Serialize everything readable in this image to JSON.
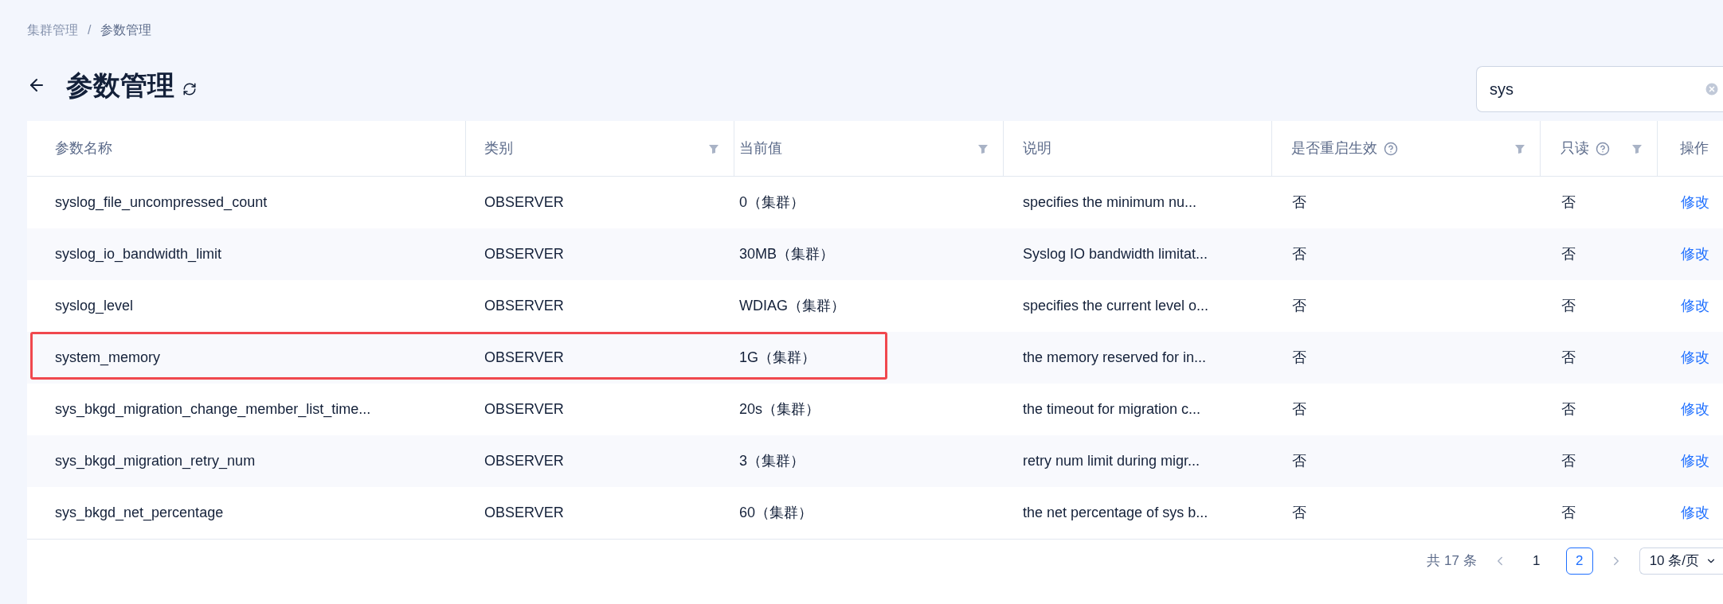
{
  "breadcrumb": [
    {
      "label": "集群管理"
    },
    {
      "label": "参数管理"
    }
  ],
  "breadcrumb_separator": "/",
  "title": "参数管理",
  "search": {
    "value": "sys"
  },
  "table": {
    "columns": [
      {
        "label": "参数名称",
        "filter": false,
        "help": false
      },
      {
        "label": "类别",
        "filter": true,
        "help": false
      },
      {
        "label": "当前值",
        "filter": true,
        "help": false
      },
      {
        "label": "说明",
        "filter": false,
        "help": false
      },
      {
        "label": "是否重启生效",
        "filter": true,
        "help": true
      },
      {
        "label": "只读",
        "filter": true,
        "help": true
      },
      {
        "label": "操作",
        "filter": false,
        "help": false
      }
    ],
    "rows": [
      {
        "name": "syslog_file_uncompressed_count",
        "category": "OBSERVER",
        "value": "0（集群）",
        "description": "specifies the minimum nu...",
        "restart": "否",
        "readonly": "否",
        "action": "修改",
        "highlighted": false
      },
      {
        "name": "syslog_io_bandwidth_limit",
        "category": "OBSERVER",
        "value": "30MB（集群）",
        "description": "Syslog IO bandwidth limitat...",
        "restart": "否",
        "readonly": "否",
        "action": "修改",
        "highlighted": false
      },
      {
        "name": "syslog_level",
        "category": "OBSERVER",
        "value": "WDIAG（集群）",
        "description": "specifies the current level o...",
        "restart": "否",
        "readonly": "否",
        "action": "修改",
        "highlighted": false
      },
      {
        "name": "system_memory",
        "category": "OBSERVER",
        "value": "1G（集群）",
        "description": "the memory reserved for in...",
        "restart": "否",
        "readonly": "否",
        "action": "修改",
        "highlighted": true
      },
      {
        "name": "sys_bkgd_migration_change_member_list_time...",
        "category": "OBSERVER",
        "value": "20s（集群）",
        "description": "the timeout for migration c...",
        "restart": "否",
        "readonly": "否",
        "action": "修改",
        "highlighted": false
      },
      {
        "name": "sys_bkgd_migration_retry_num",
        "category": "OBSERVER",
        "value": "3（集群）",
        "description": "retry num limit during migr...",
        "restart": "否",
        "readonly": "否",
        "action": "修改",
        "highlighted": false
      },
      {
        "name": "sys_bkgd_net_percentage",
        "category": "OBSERVER",
        "value": "60（集群）",
        "description": "the net percentage of sys b...",
        "restart": "否",
        "readonly": "否",
        "action": "修改",
        "highlighted": false
      }
    ]
  },
  "pagination": {
    "total": "共 17 条",
    "pages": [
      {
        "label": "1",
        "selected": false
      },
      {
        "label": "2",
        "selected": true
      }
    ],
    "page_size": "10 条/页"
  }
}
